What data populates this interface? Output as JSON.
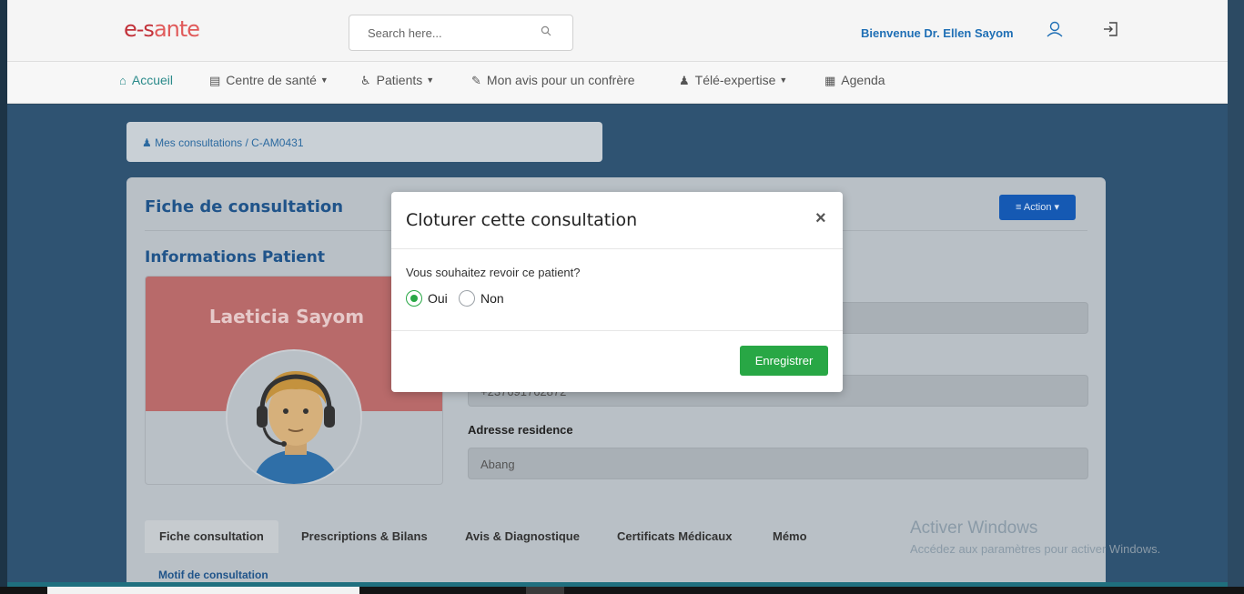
{
  "header": {
    "logo_text_a": "e-s",
    "logo_text_b": "ante",
    "search_placeholder": "Search here...",
    "welcome": "Bienvenue Dr. Ellen Sayom"
  },
  "nav": {
    "items": [
      {
        "label": "Accueil",
        "icon": "home-icon"
      },
      {
        "label": "Centre de santé",
        "icon": "building-icon"
      },
      {
        "label": "Patients",
        "icon": "wheelchair-icon"
      },
      {
        "label": "Mon avis pour un confrère",
        "icon": "edit-icon"
      },
      {
        "label": "Télé-expertise",
        "icon": "users-icon"
      },
      {
        "label": "Agenda",
        "icon": "calendar-icon"
      }
    ]
  },
  "breadcrumb": "Mes consultations  /  C-AM0431",
  "card": {
    "title": "Fiche de consultation",
    "action_label": "Action",
    "section_title": "Informations Patient",
    "patient_name": "Laeticia Sayom",
    "fields": [
      {
        "label": "",
        "value": ""
      },
      {
        "label": "",
        "value": "+237691762872"
      },
      {
        "label": "Adresse residence",
        "value": "Abang"
      }
    ],
    "tabs": [
      "Fiche consultation",
      "Prescriptions & Bilans",
      "Avis & Diagnostique",
      "Certificats Médicaux",
      "Mémo"
    ],
    "motif_label": "Motif de consultation"
  },
  "modal": {
    "title": "Cloturer cette consultation",
    "close": "×",
    "question": "Vous souhaitez revoir ce patient?",
    "option_yes": "Oui",
    "option_no": "Non",
    "selected": "Oui",
    "save_label": "Enregistrer"
  },
  "watermark": {
    "line1": "Activer Windows",
    "line2": "Accédez aux paramètres pour activer Windows."
  },
  "colors": {
    "accent": "#1f6fb5",
    "success": "#28a745",
    "overlay": "#2f5372"
  }
}
